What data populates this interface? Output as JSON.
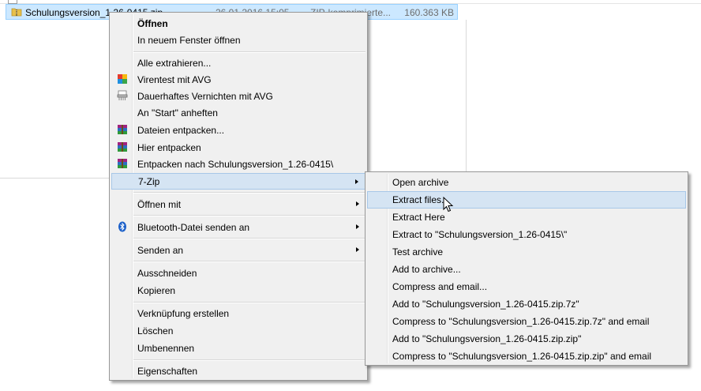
{
  "file": {
    "name": "Schulungsversion_1.26-0415.zip",
    "date": "26.01.2016 15:05",
    "type": "ZIP-komprimierte...",
    "size": "160.363 KB"
  },
  "context_menu": {
    "items": [
      {
        "label": "Öffnen",
        "bold": true
      },
      {
        "label": "In neuem Fenster öffnen"
      },
      {
        "label": "Alle extrahieren..."
      },
      {
        "label": "Virentest mit AVG",
        "icon": "avg-icon"
      },
      {
        "label": "Dauerhaftes Vernichten mit AVG",
        "icon": "shredder-icon"
      },
      {
        "label": "An \"Start\" anheften"
      },
      {
        "label": "Dateien entpacken...",
        "icon": "winrar-icon"
      },
      {
        "label": "Hier entpacken",
        "icon": "winrar-icon"
      },
      {
        "label": "Entpacken nach Schulungsversion_1.26-0415\\",
        "icon": "winrar-icon"
      },
      {
        "label": "7-Zip",
        "submenu": true,
        "highlighted": true
      },
      {
        "label": "Öffnen mit",
        "submenu": true
      },
      {
        "label": "Bluetooth-Datei senden an",
        "submenu": true,
        "icon": "bluetooth-icon"
      },
      {
        "label": "Senden an",
        "submenu": true
      },
      {
        "label": "Ausschneiden"
      },
      {
        "label": "Kopieren"
      },
      {
        "label": "Verknüpfung erstellen"
      },
      {
        "label": "Löschen"
      },
      {
        "label": "Umbenennen"
      },
      {
        "label": "Eigenschaften"
      }
    ]
  },
  "zip_submenu": {
    "items": [
      {
        "label": "Open archive"
      },
      {
        "label": "Extract files...",
        "highlighted": true
      },
      {
        "label": "Extract Here"
      },
      {
        "label": "Extract to \"Schulungsversion_1.26-0415\\\""
      },
      {
        "label": "Test archive"
      },
      {
        "label": "Add to archive..."
      },
      {
        "label": "Compress and email..."
      },
      {
        "label": "Add to \"Schulungsversion_1.26-0415.zip.7z\""
      },
      {
        "label": "Compress to \"Schulungsversion_1.26-0415.zip.7z\" and email"
      },
      {
        "label": "Add to \"Schulungsversion_1.26-0415.zip.zip\""
      },
      {
        "label": "Compress to \"Schulungsversion_1.26-0415.zip.zip\" and email"
      }
    ]
  },
  "colors": {
    "selection": "#cce8ff",
    "menu_bg": "#f0f0f0",
    "menu_highlight": "#d5e4f3"
  }
}
